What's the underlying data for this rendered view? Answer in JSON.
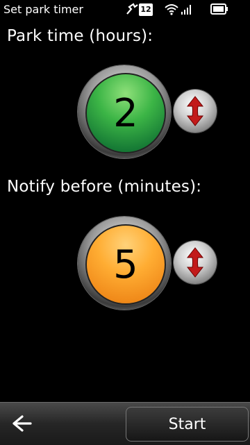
{
  "status_bar": {
    "title": "Set park timer",
    "notification_count": "12"
  },
  "park_time": {
    "label": "Park time (hours):",
    "value": "2",
    "color": "#2fa84a"
  },
  "notify_before": {
    "label": "Notify before (minutes):",
    "value": "5",
    "color": "#ff9f2a"
  },
  "toolbar": {
    "start_label": "Start",
    "back_icon": "back-arrow-icon"
  }
}
